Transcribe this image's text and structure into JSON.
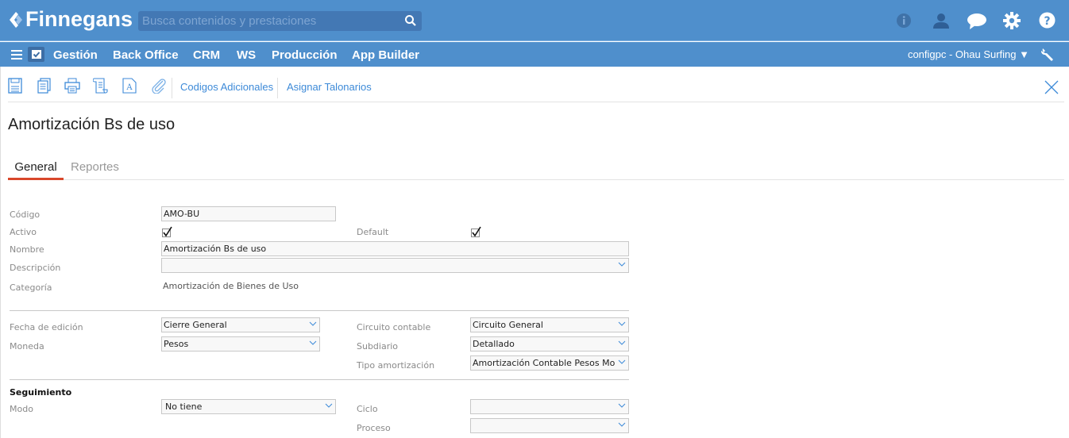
{
  "header": {
    "logo_text": "Finnegans",
    "search_placeholder": "Busca contenidos y prestaciones",
    "icons": [
      "info-icon",
      "user-icon",
      "chat-icon",
      "gear-icon",
      "help-icon"
    ]
  },
  "nav": {
    "items": [
      "Gestión",
      "Back Office",
      "CRM",
      "WS",
      "Producción",
      "App Builder"
    ],
    "user_label": "configpc - Ohau Surfing ▼"
  },
  "toolbar": {
    "links": [
      "Codigos Adicionales",
      "Asignar Talonarios"
    ]
  },
  "page": {
    "title": "Amortización Bs de uso",
    "tabs": [
      "General",
      "Reportes"
    ]
  },
  "form": {
    "codigo": {
      "label": "Código",
      "value": "AMO-BU"
    },
    "activo": {
      "label": "Activo",
      "checked": true
    },
    "default": {
      "label": "Default",
      "checked": true
    },
    "nombre": {
      "label": "Nombre",
      "value": "Amortización Bs de uso"
    },
    "descripcion": {
      "label": "Descripción",
      "value": ""
    },
    "categoria": {
      "label": "Categoría",
      "value": "Amortización de Bienes de Uso"
    },
    "fecha_edicion": {
      "label": "Fecha de edición",
      "value": "Cierre General"
    },
    "moneda": {
      "label": "Moneda",
      "value": "Pesos"
    },
    "circuito": {
      "label": "Circuito contable",
      "value": "Circuito General"
    },
    "subdiario": {
      "label": "Subdiario",
      "value": "Detallado"
    },
    "tipo_amort": {
      "label": "Tipo amortización",
      "value": "Amortización Contable Pesos Mo"
    },
    "seguimiento": "Seguimiento",
    "modo": {
      "label": "Modo",
      "value": "No tiene"
    },
    "ciclo": {
      "label": "Ciclo",
      "value": ""
    },
    "proceso": {
      "label": "Proceso",
      "value": ""
    }
  },
  "colors": {
    "header": "#4f8fcc",
    "accent": "#d9472b",
    "link": "#3d8ad8"
  }
}
